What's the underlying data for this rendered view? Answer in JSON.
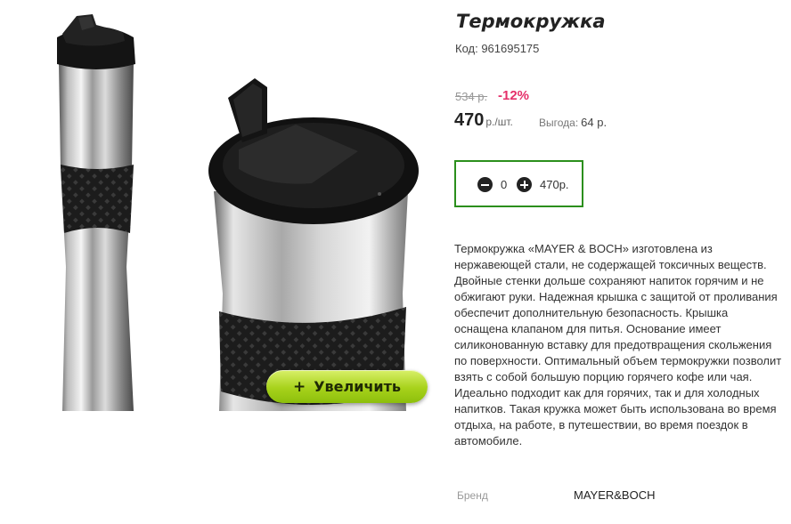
{
  "product": {
    "title": "Термокружка",
    "code": "Код: 961695175",
    "old_price": "534 р.",
    "discount": "-12%",
    "price": "470",
    "price_unit": "р./шт.",
    "benefit_label": "Выгода:",
    "benefit_value": "64 р.",
    "zoom_label": "Увеличить",
    "description": "Термокружка «MAYER & BOCH» изготовлена из нержавеющей стали, не содержащей токсичных веществ. Двойные стенки дольше сохраняют напиток горячим и не обжигают руки. Надежная крышка с защитой от проливания обеспечит дополнительную безопасность. Крышка оснащена клапаном для питья. Основание имеет силиконованную вставку для предотвращения скольжения по поверхности. Оптимальный объем термокружки позволит взять с собой большую порцию горячего кофе или чая. Идеально подходит как для горячих, так и для холодных напитков. Такая кружка может быть использована во время отдыха, на работе, в путешествии, во время поездок в автомобиле.",
    "brand_label": "Бренд",
    "brand_value": "MAYER&BOCH"
  },
  "cart": {
    "quantity": "0",
    "sum": "470р."
  },
  "icons": {
    "minus": "minus-circle-icon",
    "plus": "plus-circle-icon",
    "zoom": "plus-icon"
  },
  "colors": {
    "accent_green": "#2b8f1c",
    "discount_pink": "#e5306a",
    "zoom_button": "#a7d21b"
  }
}
